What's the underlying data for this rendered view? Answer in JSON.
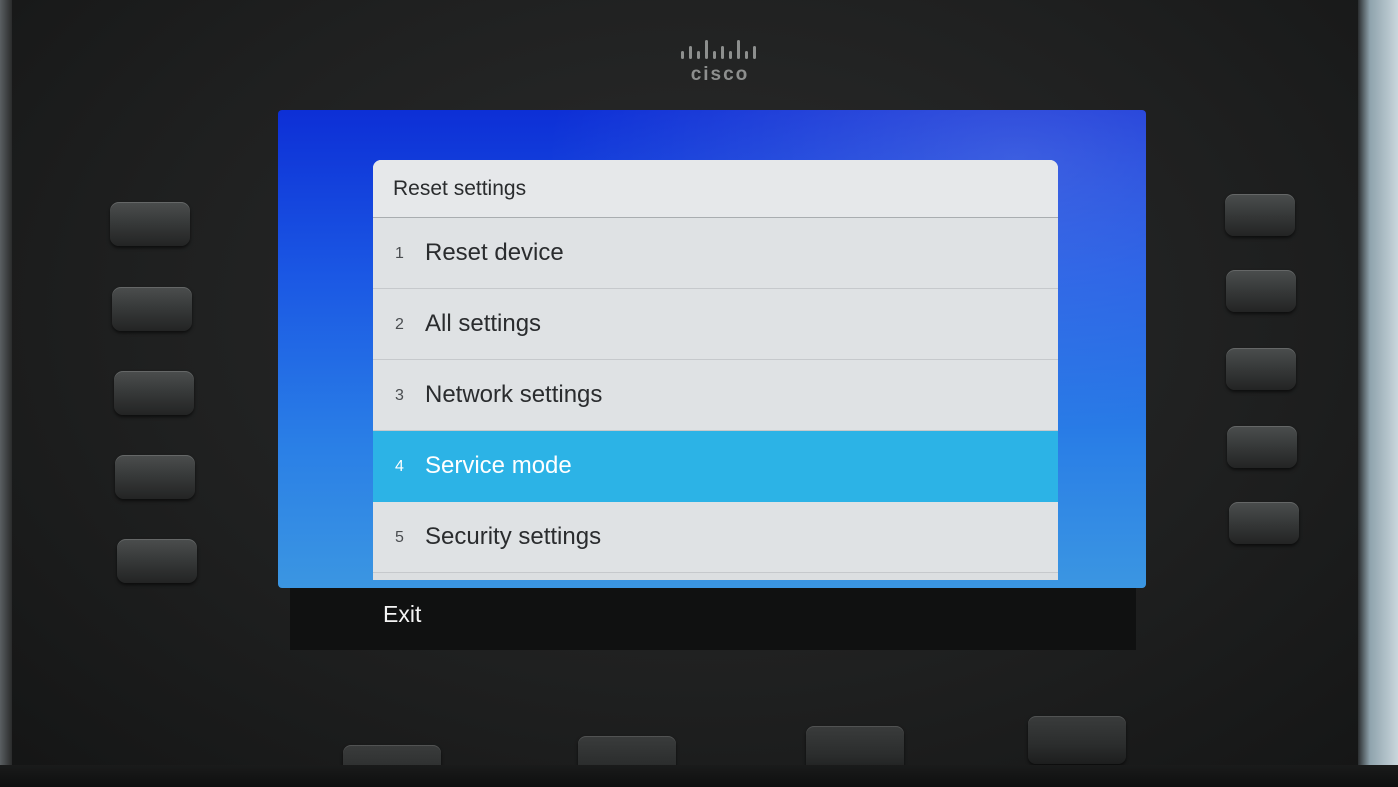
{
  "device": {
    "brand": "cisco",
    "dialog": {
      "title": "Reset settings",
      "items": [
        {
          "number": "1",
          "label": "Reset device",
          "selected": false
        },
        {
          "number": "2",
          "label": "All settings",
          "selected": false
        },
        {
          "number": "3",
          "label": "Network settings",
          "selected": false
        },
        {
          "number": "4",
          "label": "Service mode",
          "selected": true
        },
        {
          "number": "5",
          "label": "Security settings",
          "selected": false
        }
      ]
    },
    "softkeys": {
      "left_label": "Exit"
    },
    "colors": {
      "screen_background": "#1b58e4",
      "selection_highlight": "#2cb3e6",
      "dialog_background": "#dcdfe1"
    }
  }
}
